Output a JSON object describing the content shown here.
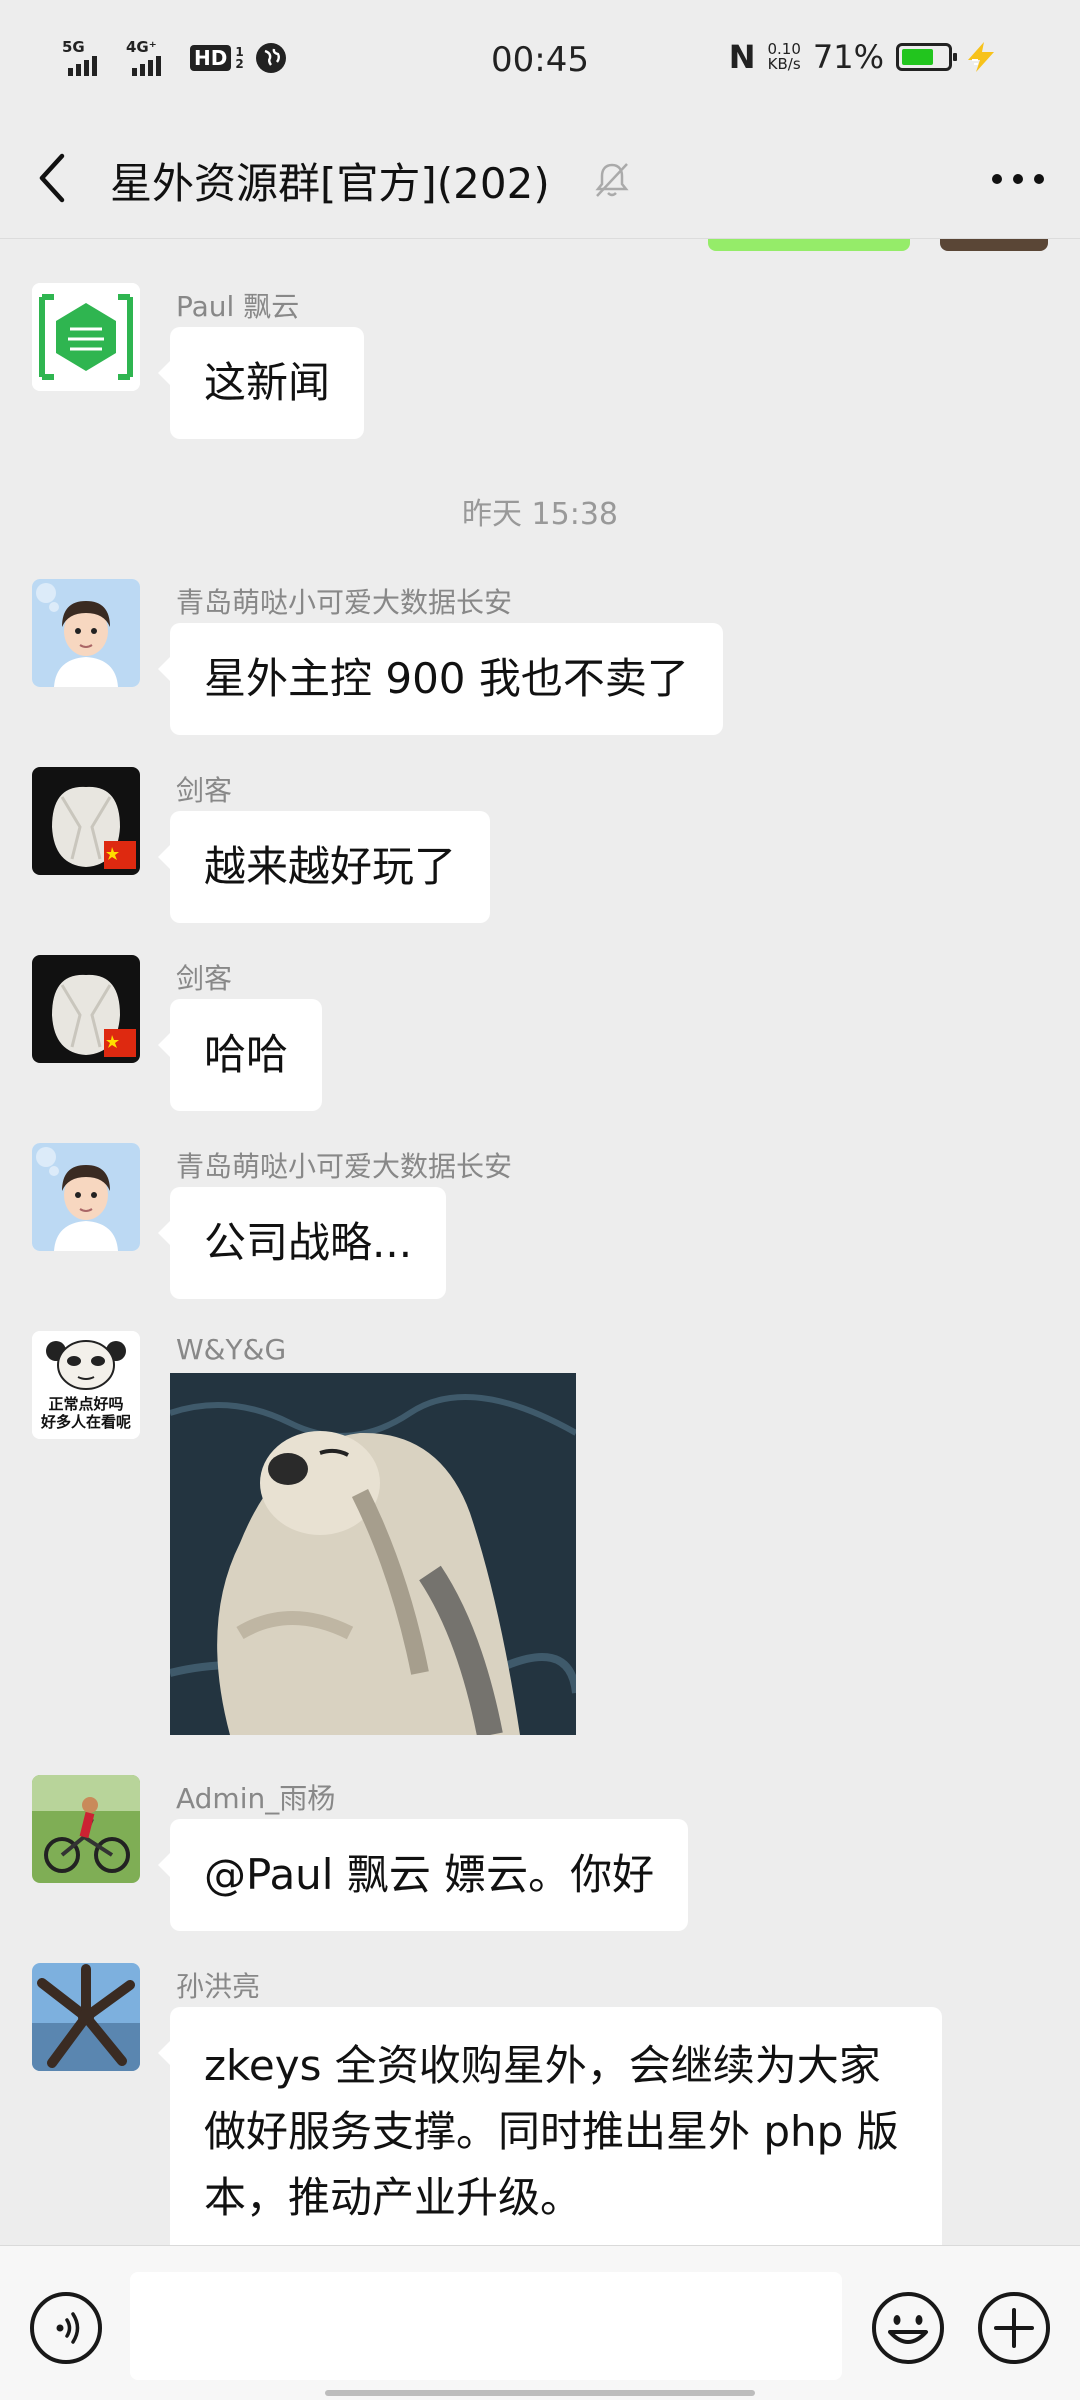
{
  "status_bar": {
    "network1": "5G",
    "network2": "4G⁺",
    "hd": "HD",
    "hd_sub": "1",
    "hd_sub2": "2",
    "time": "00:45",
    "nfc": "N",
    "speed_value": "0.10",
    "speed_unit": "KB/s",
    "battery_pct": "71%",
    "battery_level": 0.71
  },
  "nav": {
    "title": "星外资源群[官方](202)"
  },
  "messages": [
    {
      "sender": "Paul 飘云",
      "text": "这新闻"
    },
    {
      "timestamp": "昨天 15:38"
    },
    {
      "sender": "青岛萌哒小可爱大数据长安",
      "text": "星外主控 900 我也不卖了"
    },
    {
      "sender": "剑客",
      "text": "越来越好玩了"
    },
    {
      "sender": "剑客",
      "text": "哈哈"
    },
    {
      "sender": "青岛萌哒小可爱大数据长安",
      "text": "公司战略..."
    },
    {
      "sender": "W&Y&G",
      "avatar_caption_1": "正常点好吗",
      "avatar_caption_2": "好多人在看呢"
    },
    {
      "sender": "Admin_雨杨",
      "text": "@Paul 飘云  嫖云。你好"
    },
    {
      "sender": "孙洪亮",
      "text": "zkeys 全资收购星外，会继续为大家做好服务支撑。同时推出星外 php 版本，推动产业升级。"
    }
  ],
  "colors": {
    "background": "#ededed",
    "bubble": "#ffffff",
    "own_bubble": "#95ec69",
    "battery": "#22c51e"
  }
}
